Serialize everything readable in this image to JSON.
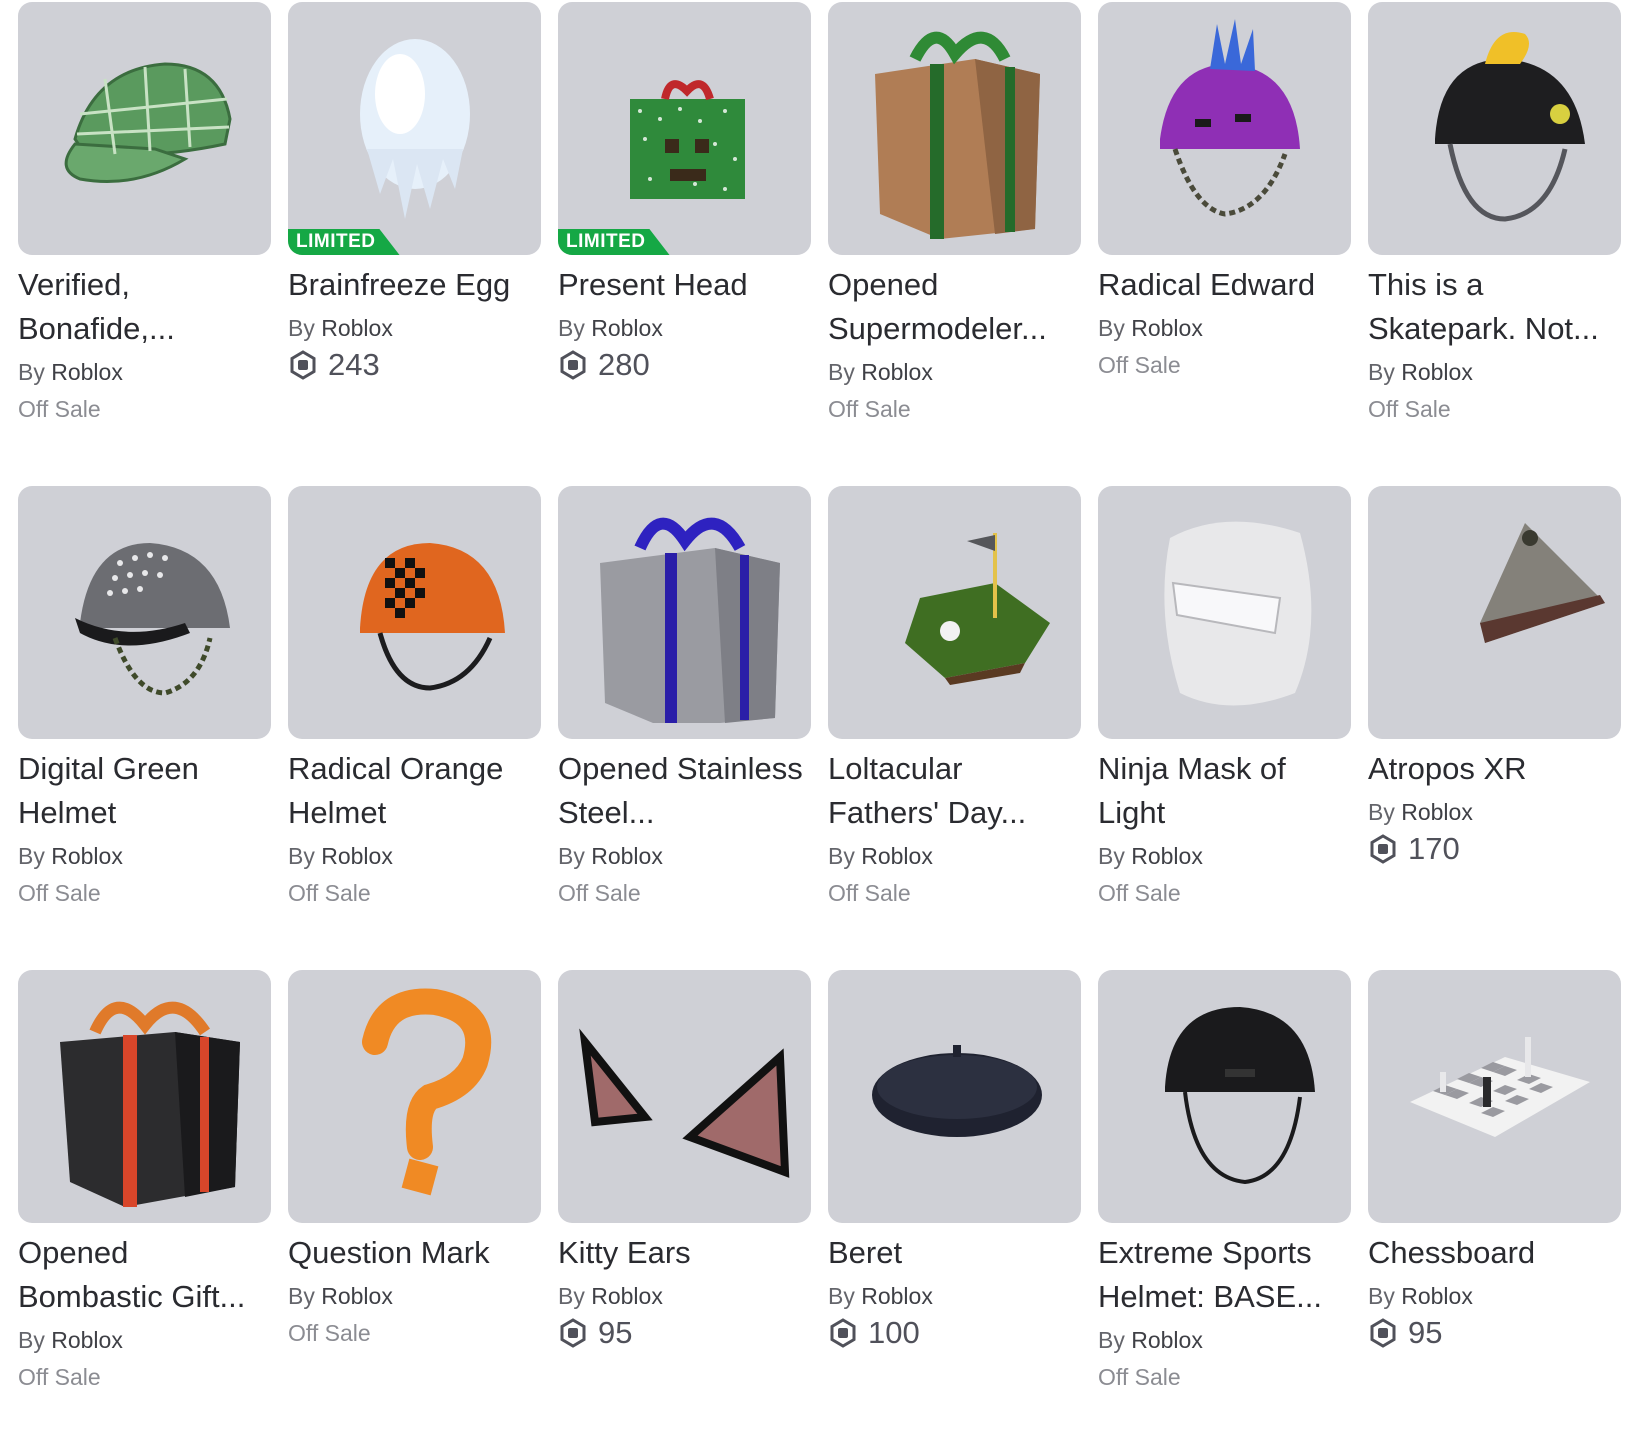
{
  "items": [
    {
      "name": "Verified, Bonafide,...",
      "by": "By",
      "creator": "Roblox",
      "status": "Off Sale",
      "icon": "green-plaid-cap"
    },
    {
      "name": "Brainfreeze Egg",
      "by": "By",
      "creator": "Roblox",
      "badge": "LIMITED",
      "price": "243",
      "icon": "brainfreeze-egg"
    },
    {
      "name": "Present Head",
      "by": "By",
      "creator": "Roblox",
      "badge": "LIMITED",
      "price": "280",
      "icon": "present-head"
    },
    {
      "name": "Opened Supermodeler...",
      "by": "By",
      "creator": "Roblox",
      "status": "Off Sale",
      "icon": "brown-gift-box"
    },
    {
      "name": "Radical Edward",
      "by": "By",
      "creator": "Roblox",
      "status": "Off Sale",
      "icon": "purple-spiked-helmet"
    },
    {
      "name": "This is a Skatepark. Not...",
      "by": "By",
      "creator": "Roblox",
      "status": "Off Sale",
      "icon": "black-mohawk-helmet"
    },
    {
      "name": "Digital Green Helmet",
      "by": "By",
      "creator": "Roblox",
      "status": "Off Sale",
      "icon": "studded-gray-helmet"
    },
    {
      "name": "Radical Orange Helmet",
      "by": "By",
      "creator": "Roblox",
      "status": "Off Sale",
      "icon": "orange-checkered-helmet"
    },
    {
      "name": "Opened Stainless Steel...",
      "by": "By",
      "creator": "Roblox",
      "status": "Off Sale",
      "icon": "steel-gift-box"
    },
    {
      "name": "Loltacular Fathers' Day...",
      "by": "By",
      "creator": "Roblox",
      "status": "Off Sale",
      "icon": "golf-green"
    },
    {
      "name": "Ninja Mask of Light",
      "by": "By",
      "creator": "Roblox",
      "status": "Off Sale",
      "icon": "white-ninja-mask"
    },
    {
      "name": "Atropos XR",
      "by": "By",
      "creator": "Roblox",
      "price": "170",
      "icon": "gray-pyramid-hat"
    },
    {
      "name": "Opened Bombastic Gift...",
      "by": "By",
      "creator": "Roblox",
      "status": "Off Sale",
      "icon": "black-gift-box"
    },
    {
      "name": "Question Mark",
      "by": "By",
      "creator": "Roblox",
      "status": "Off Sale",
      "icon": "orange-question-mark"
    },
    {
      "name": "Kitty Ears",
      "by": "By",
      "creator": "Roblox",
      "price": "95",
      "icon": "cat-ears"
    },
    {
      "name": "Beret",
      "by": "By",
      "creator": "Roblox",
      "price": "100",
      "icon": "black-beret"
    },
    {
      "name": "Extreme Sports Helmet: BASE...",
      "by": "By",
      "creator": "Roblox",
      "status": "Off Sale",
      "icon": "black-sports-helmet"
    },
    {
      "name": "Chessboard",
      "by": "By",
      "creator": "Roblox",
      "price": "95",
      "icon": "chessboard"
    }
  ],
  "colors": {
    "thumb_bg": "#cfd0d6",
    "limited": "#15a845",
    "text": "#2a2b30",
    "muted": "#8b8c92"
  }
}
